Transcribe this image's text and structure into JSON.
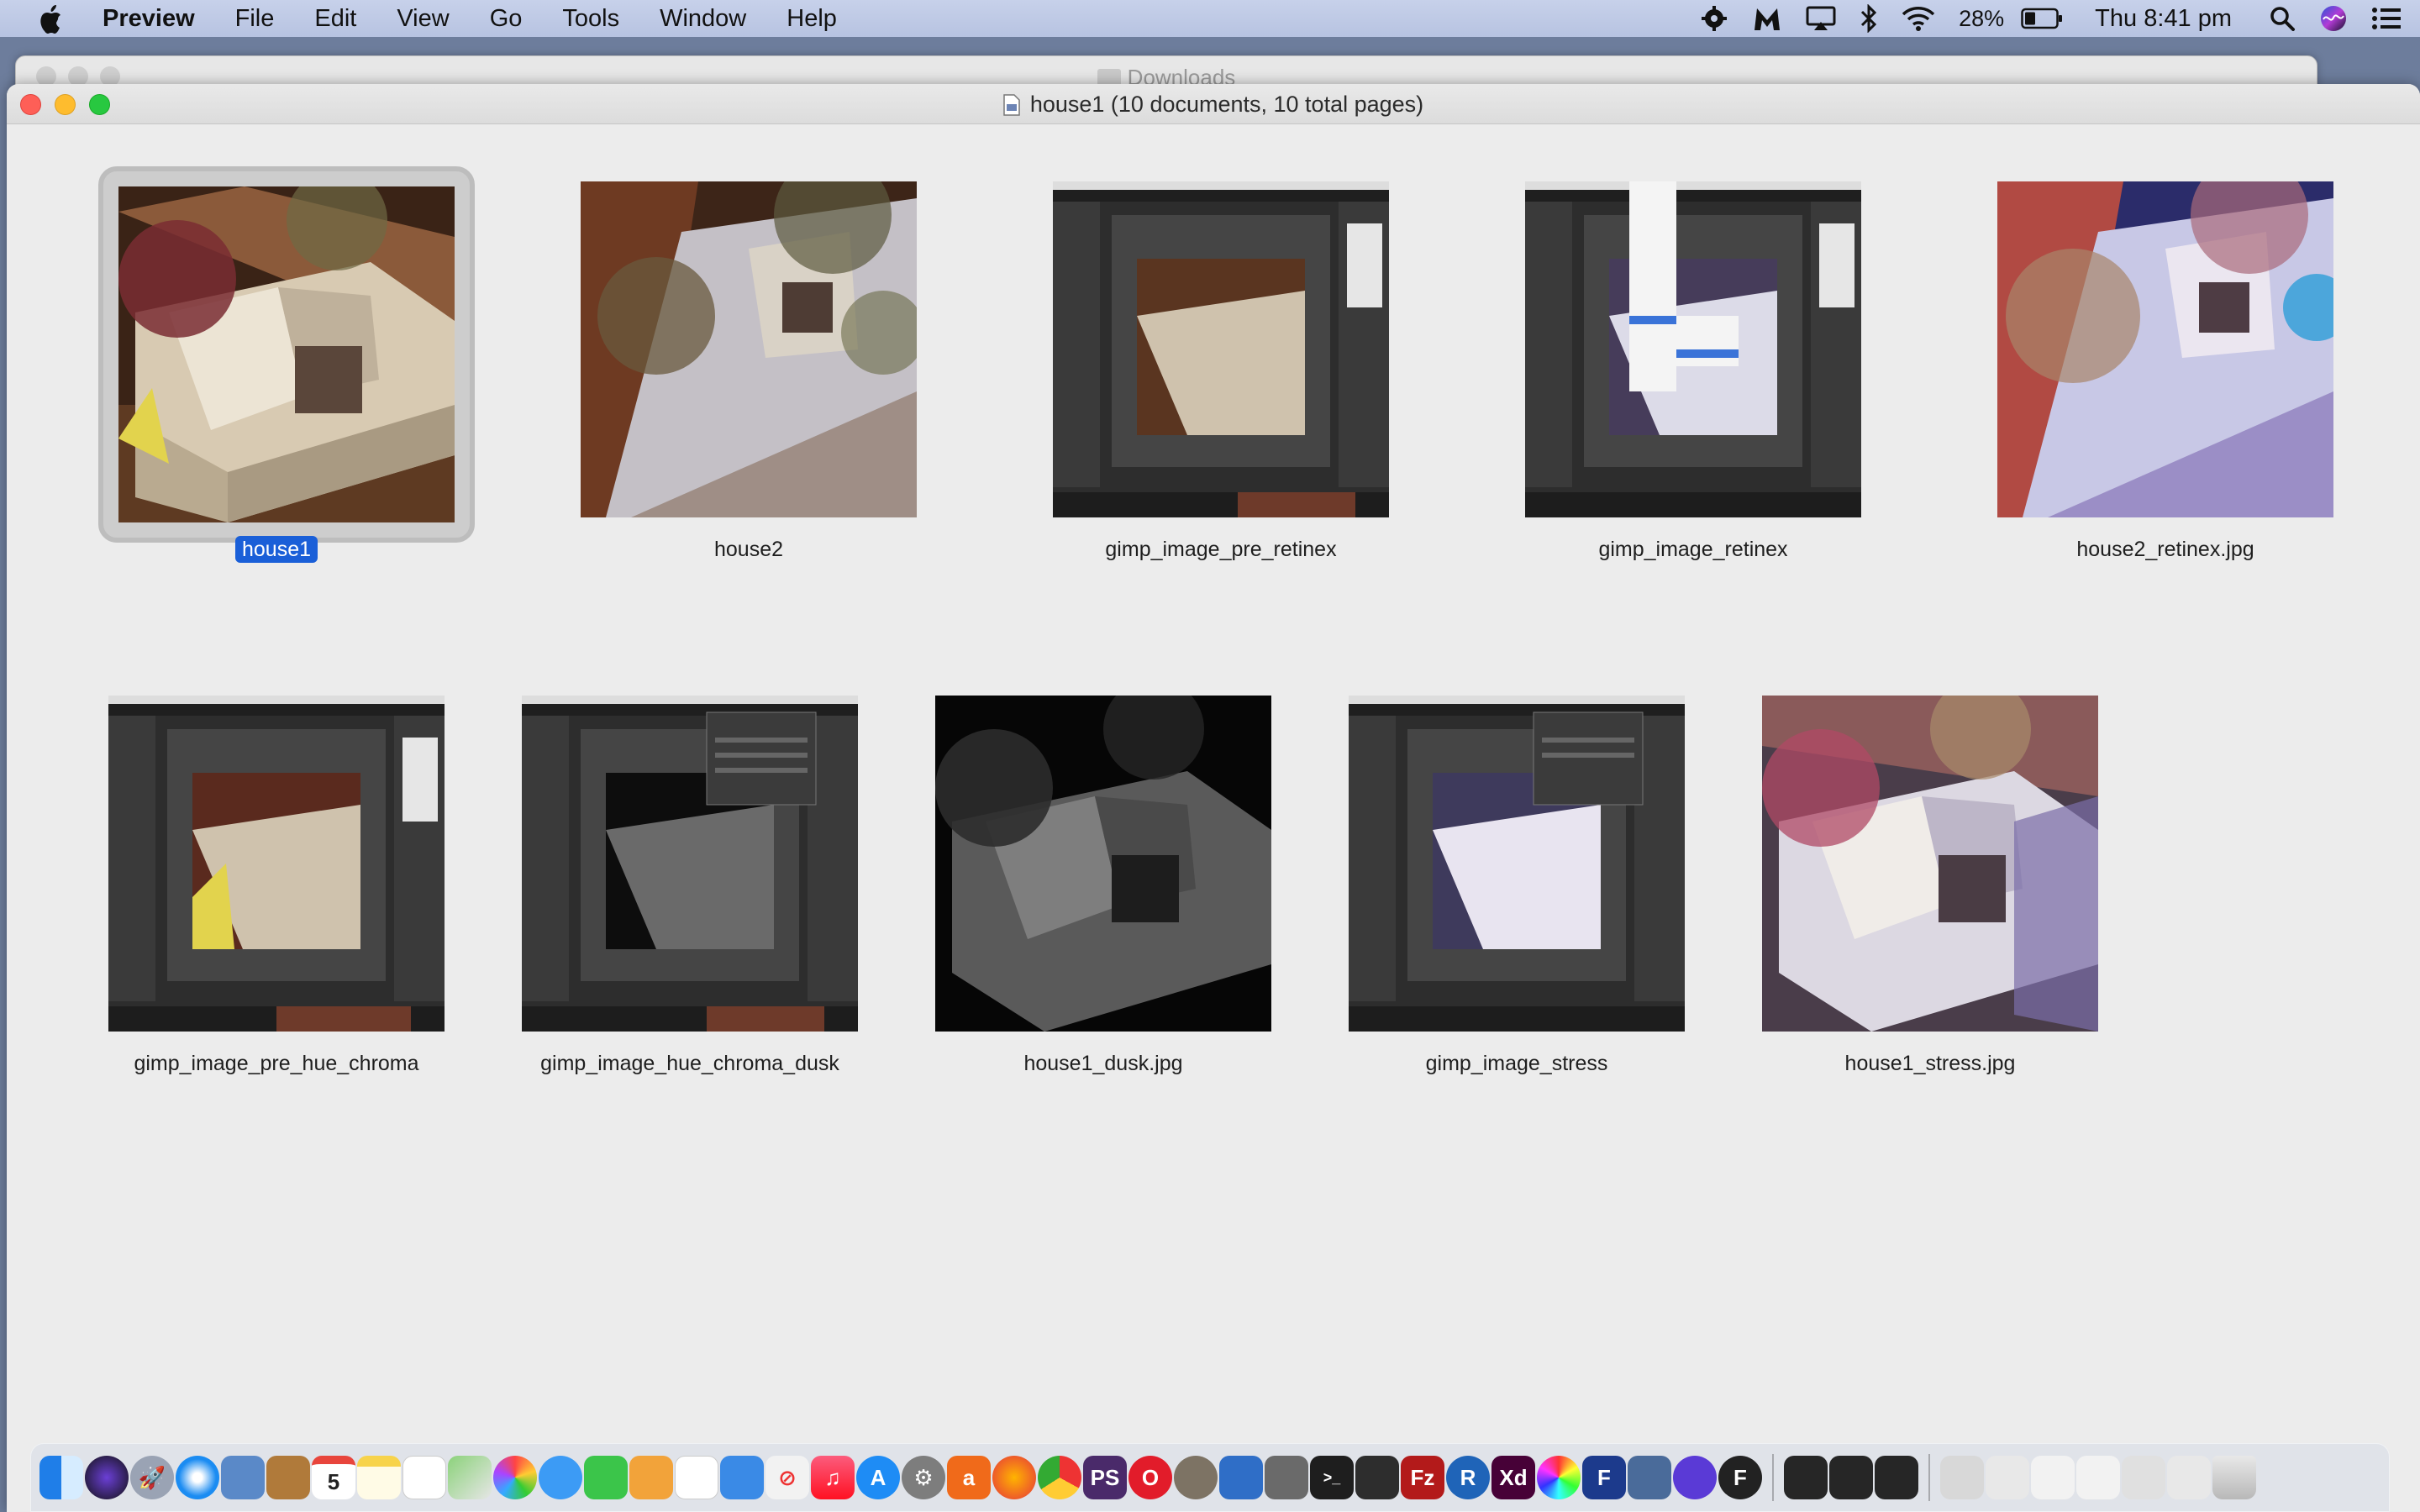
{
  "menubar": {
    "app": "Preview",
    "items": [
      "File",
      "Edit",
      "View",
      "Go",
      "Tools",
      "Window",
      "Help"
    ],
    "battery": "28%",
    "clock": "Thu 8:41 pm"
  },
  "background_window": {
    "title": "Downloads"
  },
  "window": {
    "title": "house1 (10 documents, 10 total pages)"
  },
  "documents": [
    {
      "label": "house1",
      "selected": true
    },
    {
      "label": "house2",
      "selected": false
    },
    {
      "label": "gimp_image_pre_retinex",
      "selected": false
    },
    {
      "label": "gimp_image_retinex",
      "selected": false
    },
    {
      "label": "house2_retinex.jpg",
      "selected": false
    },
    {
      "label": "gimp_image_pre_hue_chroma",
      "selected": false
    },
    {
      "label": "gimp_image_hue_chroma_dusk",
      "selected": false
    },
    {
      "label": "house1_dusk.jpg",
      "selected": false
    },
    {
      "label": "gimp_image_stress",
      "selected": false
    },
    {
      "label": "house1_stress.jpg",
      "selected": false
    }
  ],
  "dock": {
    "calendar_day": "5",
    "icons": [
      "finder-icon",
      "siri-icon",
      "launchpad-icon",
      "safari-icon",
      "preview-icon",
      "notes-brown-icon",
      "calendar-icon",
      "notes-icon",
      "reminders-icon",
      "maps-icon",
      "photos-icon",
      "messages-icon",
      "facetime-icon",
      "pages-icon",
      "numbers-icon",
      "keynote-icon",
      "news-icon",
      "music-icon",
      "app-store-icon",
      "system-preferences-icon",
      "audacity-icon",
      "firefox-icon",
      "chrome-icon",
      "photoshop-icon",
      "opera-icon",
      "gimp-icon",
      "filezilla-icon",
      "r-icon",
      "xd-icon",
      "terminal-icon",
      "trash-icon"
    ]
  }
}
